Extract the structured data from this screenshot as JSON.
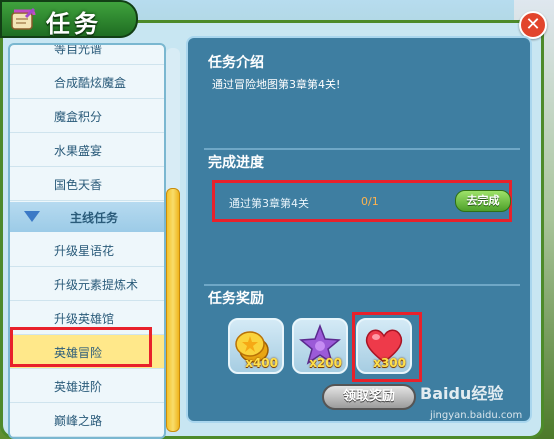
{
  "window": {
    "title": "任务",
    "close_symbol": "✕"
  },
  "sidebar": {
    "items": [
      {
        "label": "等自光谱",
        "type": "item"
      },
      {
        "label": "合成酷炫魔盒",
        "type": "item"
      },
      {
        "label": "魔盒积分",
        "type": "item"
      },
      {
        "label": "水果盛宴",
        "type": "item"
      },
      {
        "label": "国色天香",
        "type": "item"
      },
      {
        "label": "主线任务",
        "type": "section"
      },
      {
        "label": "升级星语花",
        "type": "item"
      },
      {
        "label": "升级元素提炼术",
        "type": "item"
      },
      {
        "label": "升级英雄馆",
        "type": "item"
      },
      {
        "label": "英雄冒险",
        "type": "item",
        "active": true
      },
      {
        "label": "英雄进阶",
        "type": "item"
      },
      {
        "label": "巅峰之路",
        "type": "item"
      }
    ]
  },
  "panel": {
    "intro_heading": "任务介绍",
    "intro_text": "通过冒险地图第3章第4关!",
    "progress_heading": "完成进度",
    "progress_label": "通过第3章第4关",
    "progress_count": "0/1",
    "go_button": "去完成",
    "rewards_heading": "任务奖励",
    "rewards": [
      {
        "icon": "coin-icon",
        "qty": "x400"
      },
      {
        "icon": "star-icon",
        "qty": "x200"
      },
      {
        "icon": "heart-icon",
        "qty": "x300"
      }
    ],
    "claim_button": "领取奖励"
  },
  "watermark": {
    "text": "Baidu经验",
    "sub": "jingyan.baidu.com"
  },
  "colors": {
    "highlight": "#e8212b",
    "panel_bg": "#3e7ea1",
    "title_green": "#1f6d22"
  }
}
